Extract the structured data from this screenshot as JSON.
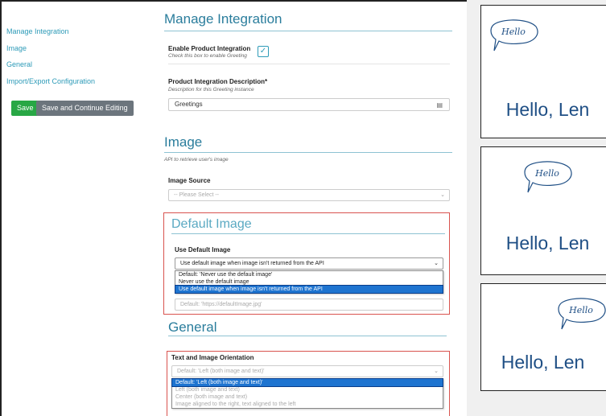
{
  "sidebar": {
    "nav": [
      {
        "label": "Manage Integration"
      },
      {
        "label": "Image"
      },
      {
        "label": "General"
      },
      {
        "label": "Import/Export Configuration"
      }
    ],
    "save_label": "Save",
    "save_continue_label": "Save and Continue Editing"
  },
  "manage": {
    "title": "Manage Integration",
    "enable_label": "Enable Product Integration",
    "enable_help": "Check this box to enable Greeting",
    "enable_checked": true,
    "desc_label": "Product Integration Description*",
    "desc_help": "Description for this Greeting instance",
    "desc_value": "Greetings"
  },
  "image": {
    "title": "Image",
    "help": "API to retrieve user's image",
    "source_label": "Image Source",
    "source_placeholder": "-- Please Select --"
  },
  "default_image": {
    "title": "Default Image",
    "use_label": "Use Default Image",
    "use_value": "Use default image when image isn't returned from the API",
    "options": [
      "Default: 'Never use the default image'",
      "Never use the default image",
      "Use default image when image isn't returned from the API"
    ],
    "selected_index": 2,
    "url_placeholder": "Default: 'https://defaultImage.jpg'"
  },
  "general": {
    "title": "General",
    "orientation_label": "Text and Image Orientation",
    "orientation_value": "Default: 'Left (both image and text)'",
    "options": [
      "Default: 'Left (both image and text)'",
      "Left (both image and text)",
      "Center (both image and text)",
      "Image aligned to the right, text aligned to the left"
    ],
    "selected_index": 0
  },
  "preview": {
    "bubble_text": "Hello",
    "cards": [
      {
        "greeting": "Hello, Len"
      },
      {
        "greeting": "Hello, Len"
      },
      {
        "greeting": "Hello, Len"
      }
    ]
  },
  "colors": {
    "accent": "#2e9bb8",
    "heading": "#2a7d9c",
    "save": "#28a745",
    "secondary": "#6c757d",
    "highlight_box": "#d9534f",
    "greeting_text": "#1f4f85"
  }
}
